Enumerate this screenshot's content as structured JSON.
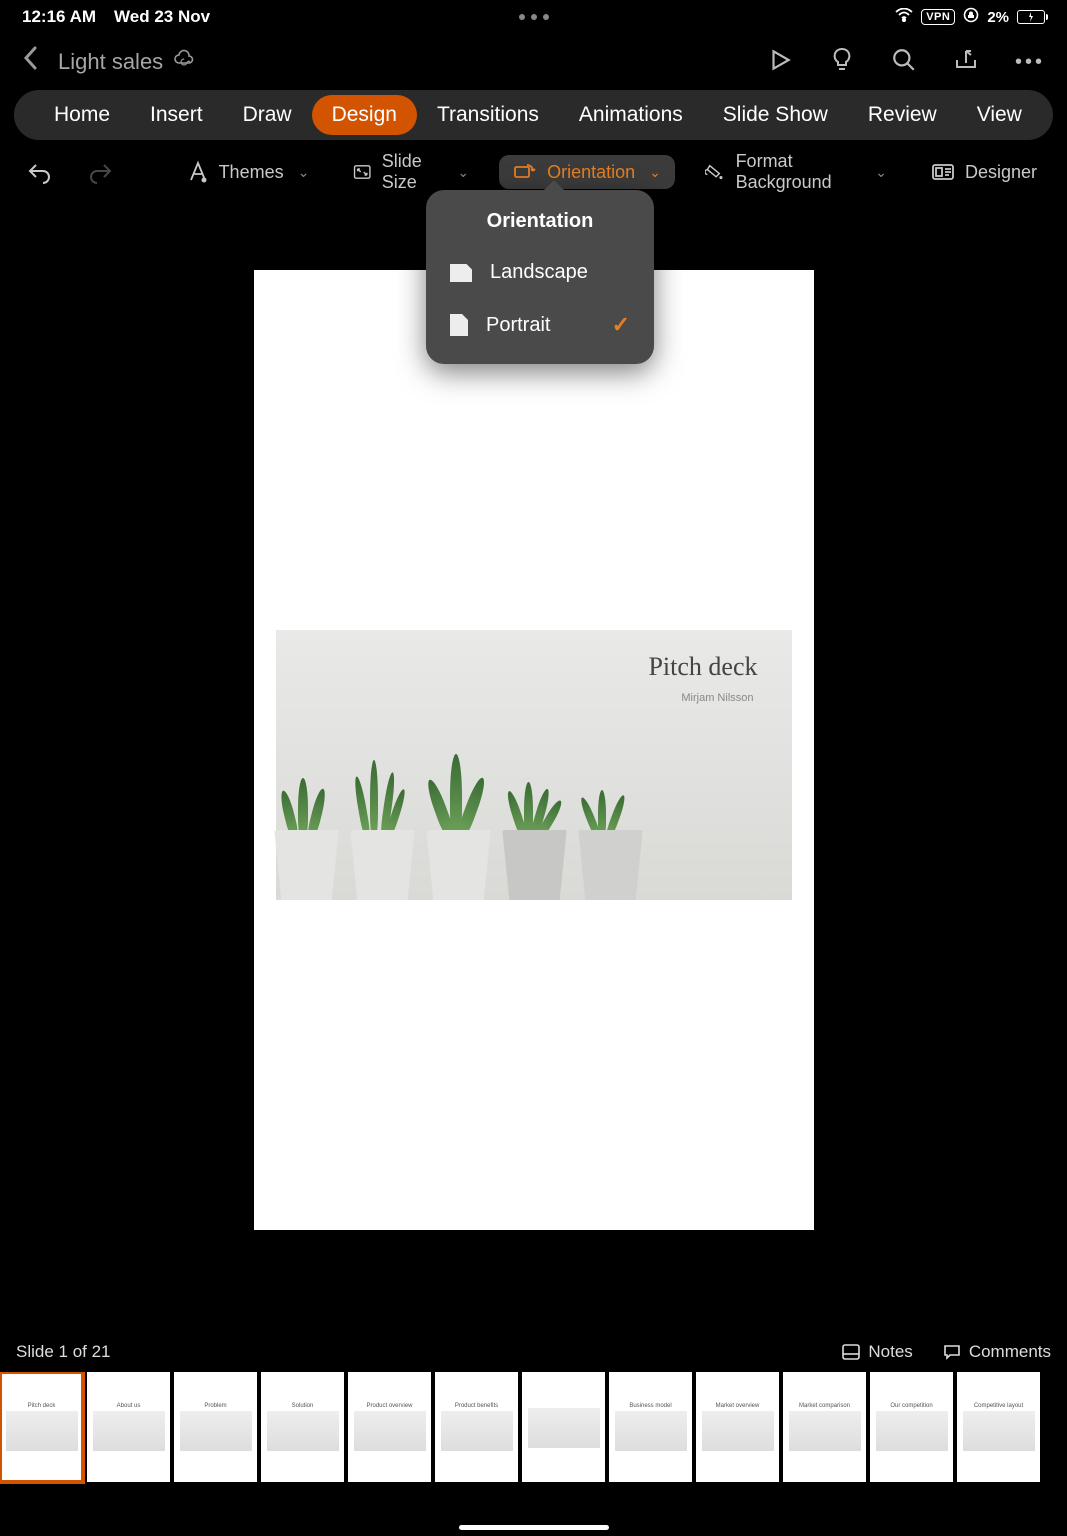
{
  "status": {
    "time": "12:16 AM",
    "date": "Wed 23 Nov",
    "vpn": "VPN",
    "battery": "2%"
  },
  "titlebar": {
    "doc_name": "Light sales"
  },
  "ribbon": {
    "tabs": [
      "Home",
      "Insert",
      "Draw",
      "Design",
      "Transitions",
      "Animations",
      "Slide Show",
      "Review",
      "View"
    ],
    "active_index": 3
  },
  "toolbar": {
    "themes": "Themes",
    "slide_size": "Slide Size",
    "orientation": "Orientation",
    "format_bg": "Format Background",
    "designer": "Designer"
  },
  "popover": {
    "title": "Orientation",
    "options": [
      {
        "label": "Landscape",
        "selected": false
      },
      {
        "label": "Portrait",
        "selected": true
      }
    ]
  },
  "slide_content": {
    "title": "Pitch deck",
    "subtitle": "Mirjam Nilsson"
  },
  "footer": {
    "status": "Slide 1 of 21",
    "notes": "Notes",
    "comments": "Comments"
  },
  "thumbs": {
    "count": 12,
    "labels": [
      "Pitch deck",
      "About us",
      "Problem",
      "Solution",
      "Product overview",
      "Product benefits",
      "",
      "Business model",
      "Market overview",
      "Market comparison",
      "Our competition",
      "Competitive layout"
    ]
  }
}
